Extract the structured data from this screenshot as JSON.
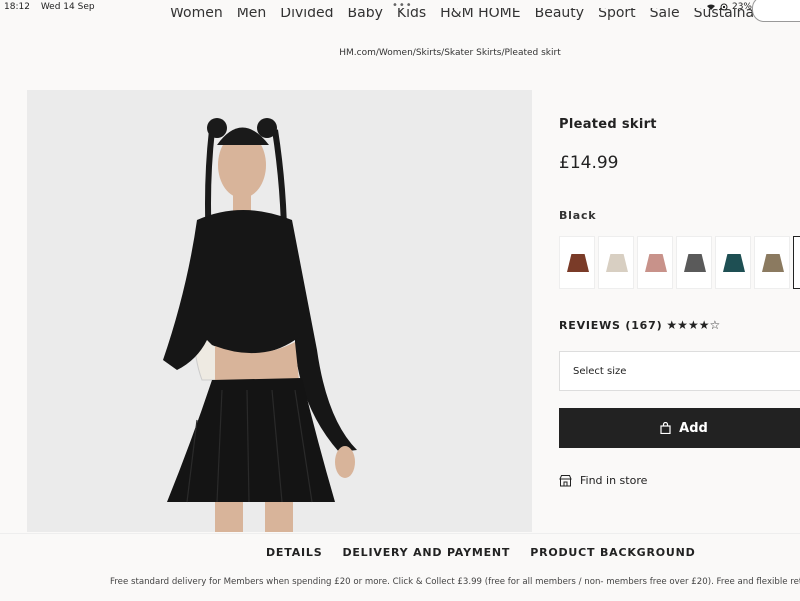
{
  "status": {
    "time": "18:12",
    "date": "Wed 14 Sep",
    "battery": "23%",
    "battery_level": 0.23
  },
  "nav": {
    "items": [
      "Women",
      "Men",
      "Divided",
      "Baby",
      "Kids",
      "H&M HOME",
      "Beauty",
      "Sport",
      "Sale",
      "Sustainability"
    ]
  },
  "breadcrumb": "HM.com/Women/Skirts/Skater Skirts/Pleated skirt",
  "product": {
    "title": "Pleated skirt",
    "price": "£14.99",
    "color_name": "Black",
    "swatch_colors": [
      "#7a3b28",
      "#d8cfc2",
      "#c8928a",
      "#5a5a5a",
      "#1e4f53",
      "#8b7a60",
      "#222222"
    ],
    "reviews_label": "REVIEWS (167)",
    "rating": 4,
    "rating_max": 5,
    "size_placeholder": "Select size",
    "add_label": "Add",
    "find_in_store": "Find in store"
  },
  "bottom": {
    "tabs": [
      "DETAILS",
      "DELIVERY AND PAYMENT",
      "PRODUCT BACKGROUND"
    ],
    "delivery_note": "Free standard delivery for Members when spending £20 or more. Click & Collect £3.99 (free for all members / non- members free over £20). Free and flexible returns"
  },
  "colors": {
    "button": "#222222",
    "background": "#faf9f8",
    "image_bg": "#e9e9e9"
  }
}
